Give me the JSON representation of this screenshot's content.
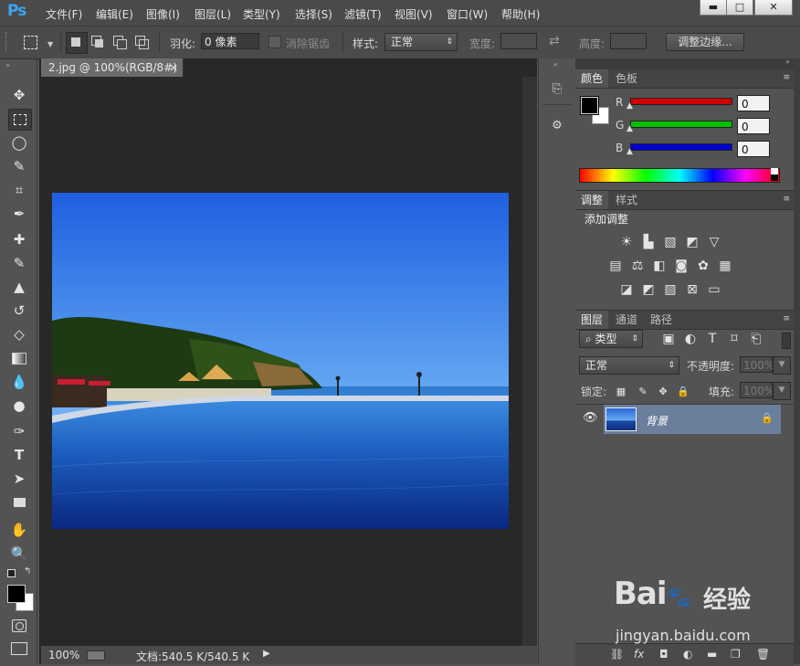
{
  "app": {
    "logo": "Ps"
  },
  "menu": [
    "文件(F)",
    "编辑(E)",
    "图像(I)",
    "图层(L)",
    "类型(Y)",
    "选择(S)",
    "滤镜(T)",
    "视图(V)",
    "窗口(W)",
    "帮助(H)"
  ],
  "window_controls": {
    "minimize": "▬",
    "maximize": "□",
    "close": "✕"
  },
  "options": {
    "feather_label": "羽化:",
    "feather_value": "0 像素",
    "antialias_label": "消除锯齿",
    "style_label": "样式:",
    "style_value": "正常",
    "width_label": "宽度:",
    "height_label": "高度:",
    "refine_button": "调整边缘..."
  },
  "document": {
    "tab_title": "2.jpg @ 100%(RGB/8#)",
    "close": "×"
  },
  "status": {
    "zoom": "100%",
    "doc_info": "文档:540.5 K/540.5 K"
  },
  "color_panel": {
    "tabs": [
      "颜色",
      "色板"
    ],
    "channels": [
      {
        "label": "R",
        "value": "0",
        "color": "#e00000"
      },
      {
        "label": "G",
        "value": "0",
        "color": "#00d000"
      },
      {
        "label": "B",
        "value": "0",
        "color": "#0000e0"
      }
    ]
  },
  "adjust_panel": {
    "tabs": [
      "调整",
      "样式"
    ],
    "title": "添加调整"
  },
  "layers_panel": {
    "tabs": [
      "图层",
      "通道",
      "路径"
    ],
    "filter_value": "类型",
    "blend_value": "正常",
    "opacity_label": "不透明度:",
    "opacity_value": "100%",
    "lock_label": "锁定:",
    "fill_label": "填充:",
    "fill_value": "100%",
    "layers": [
      {
        "name": "背景",
        "visible": true,
        "locked": true
      }
    ]
  },
  "watermark": {
    "brand": "Bai",
    "brand2": "经验",
    "url": "jingyan.baidu.com"
  }
}
